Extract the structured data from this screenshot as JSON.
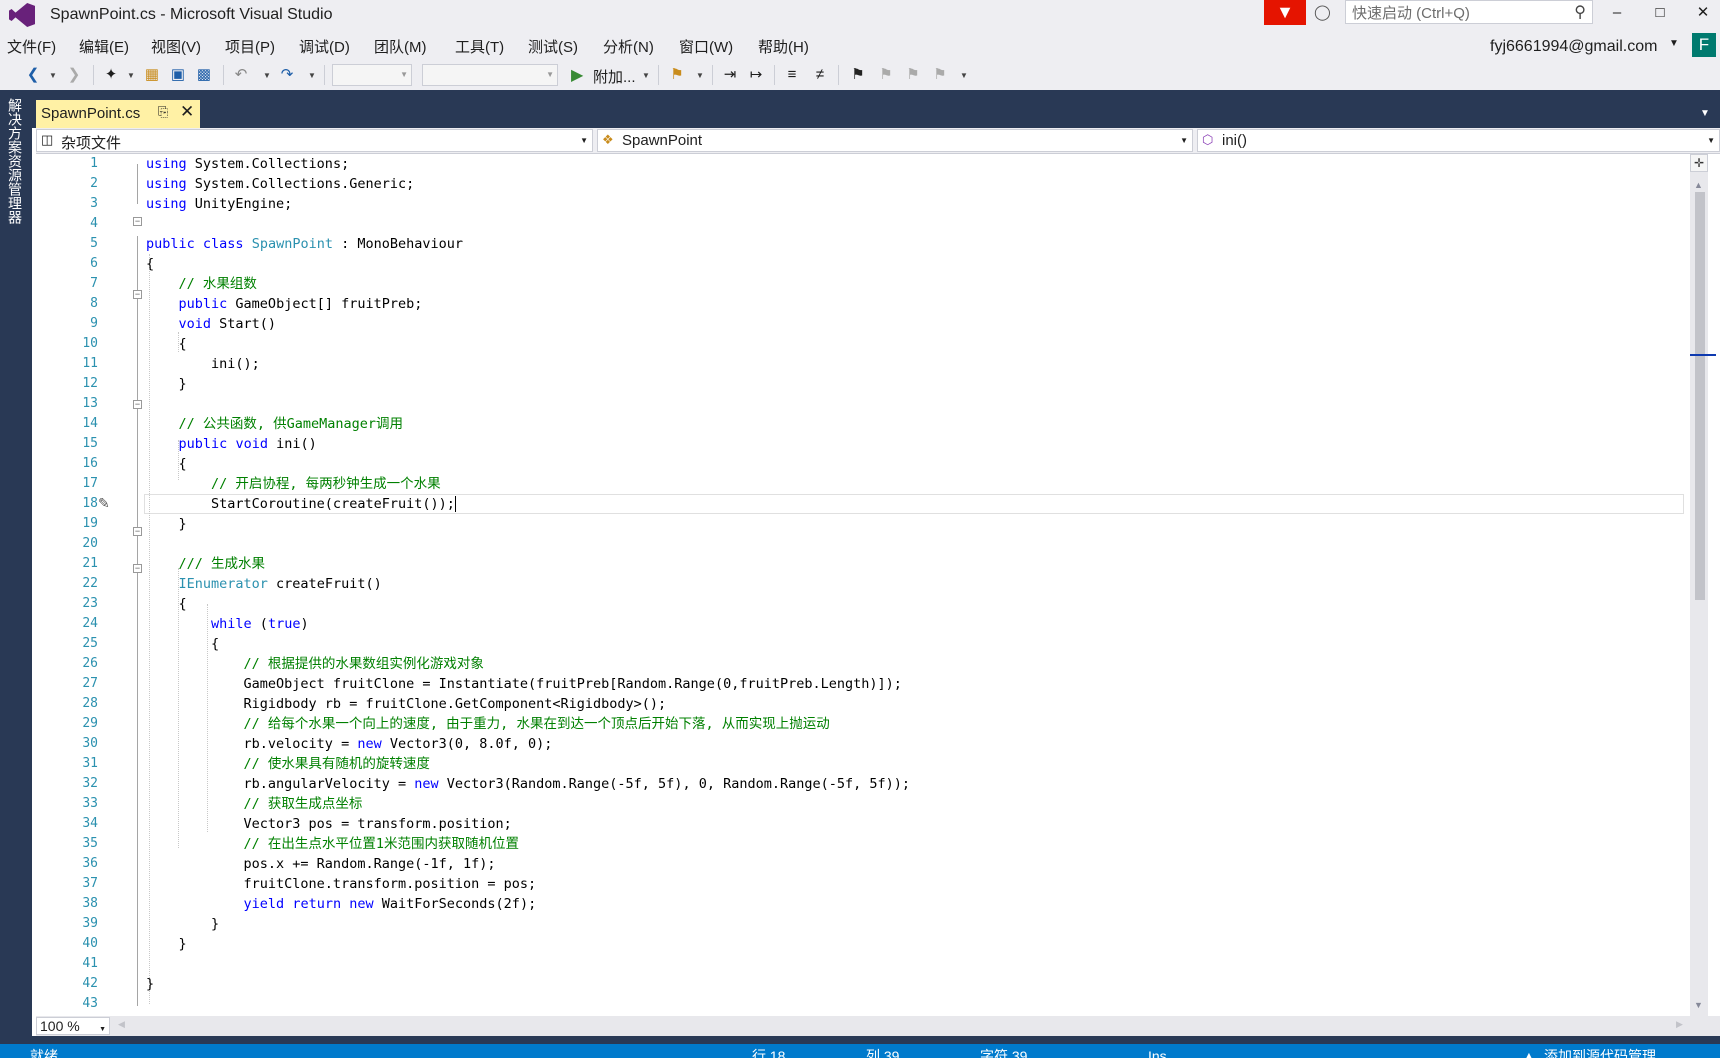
{
  "window": {
    "title": "SpawnPoint.cs - Microsoft Visual Studio",
    "quick_launch_placeholder": "快速启动 (Ctrl+Q)",
    "minimize": "–",
    "maximize": "□",
    "close": "✕"
  },
  "menu": [
    "文件(F)",
    "编辑(E)",
    "视图(V)",
    "项目(P)",
    "调试(D)",
    "团队(M)",
    "工具(T)",
    "测试(S)",
    "分析(N)",
    "窗口(W)",
    "帮助(H)"
  ],
  "account": {
    "email": "fyj6661994@gmail.com",
    "avatar_letter": "F"
  },
  "toolbar": {
    "attach_label": "附加..."
  },
  "solution_explorer_tab": "解决方案资源管理器",
  "document_tab": {
    "label": "SpawnPoint.cs"
  },
  "nav": {
    "project": "杂项文件",
    "class": "SpawnPoint",
    "member": "ini()"
  },
  "editor": {
    "current_line": 18,
    "line_numbers": [
      "1",
      "2",
      "3",
      "4",
      "5",
      "6",
      "7",
      "8",
      "9",
      "10",
      "11",
      "12",
      "13",
      "14",
      "15",
      "16",
      "17",
      "18",
      "19",
      "20",
      "21",
      "22",
      "23",
      "24",
      "25",
      "26",
      "27",
      "28",
      "29",
      "30",
      "31",
      "32",
      "33",
      "34",
      "35",
      "36",
      "37",
      "38",
      "39",
      "40",
      "41",
      "42",
      "43"
    ],
    "code": [
      [
        {
          "t": "using",
          "c": "kw"
        },
        {
          "t": " System.Collections;"
        }
      ],
      [
        {
          "t": "using",
          "c": "kw"
        },
        {
          "t": " System.Collections.Generic;"
        }
      ],
      [
        {
          "t": "using",
          "c": "kw"
        },
        {
          "t": " UnityEngine;"
        }
      ],
      [],
      [
        {
          "t": "public",
          "c": "kw"
        },
        {
          "t": " "
        },
        {
          "t": "class",
          "c": "kw"
        },
        {
          "t": " "
        },
        {
          "t": "SpawnPoint",
          "c": "ty"
        },
        {
          "t": " : MonoBehaviour"
        }
      ],
      [
        {
          "t": "{"
        }
      ],
      [
        {
          "t": "    "
        },
        {
          "t": "// 水果组数",
          "c": "cm"
        }
      ],
      [
        {
          "t": "    "
        },
        {
          "t": "public",
          "c": "kw"
        },
        {
          "t": " GameObject[] fruitPreb;"
        }
      ],
      [
        {
          "t": "    "
        },
        {
          "t": "void",
          "c": "kw"
        },
        {
          "t": " Start()"
        }
      ],
      [
        {
          "t": "    {"
        }
      ],
      [
        {
          "t": "        ini();"
        }
      ],
      [
        {
          "t": "    }"
        }
      ],
      [],
      [
        {
          "t": "    "
        },
        {
          "t": "// 公共函数, 供GameManager调用",
          "c": "cm"
        }
      ],
      [
        {
          "t": "    "
        },
        {
          "t": "public",
          "c": "kw"
        },
        {
          "t": " "
        },
        {
          "t": "void",
          "c": "kw"
        },
        {
          "t": " ini()"
        }
      ],
      [
        {
          "t": "    {"
        }
      ],
      [
        {
          "t": "        "
        },
        {
          "t": "// 开启协程, 每两秒钟生成一个水果",
          "c": "cm"
        }
      ],
      [
        {
          "t": "        StartCoroutine(createFruit());"
        },
        {
          "caret": true
        }
      ],
      [
        {
          "t": "    }"
        }
      ],
      [],
      [
        {
          "t": "    "
        },
        {
          "t": "/// 生成水果",
          "c": "cm"
        }
      ],
      [
        {
          "t": "    "
        },
        {
          "t": "IEnumerator",
          "c": "ty"
        },
        {
          "t": " createFruit()"
        }
      ],
      [
        {
          "t": "    {"
        }
      ],
      [
        {
          "t": "        "
        },
        {
          "t": "while",
          "c": "kw"
        },
        {
          "t": " ("
        },
        {
          "t": "true",
          "c": "kw"
        },
        {
          "t": ")"
        }
      ],
      [
        {
          "t": "        {"
        }
      ],
      [
        {
          "t": "            "
        },
        {
          "t": "// 根据提供的水果数组实例化游戏对象",
          "c": "cm"
        }
      ],
      [
        {
          "t": "            GameObject fruitClone = Instantiate(fruitPreb[Random.Range(0,fruitPreb.Length)]);"
        }
      ],
      [
        {
          "t": "            Rigidbody rb = fruitClone.GetComponent<Rigidbody>();"
        }
      ],
      [
        {
          "t": "            "
        },
        {
          "t": "// 给每个水果一个向上的速度, 由于重力, 水果在到达一个顶点后开始下落, 从而实现上抛运动",
          "c": "cm"
        }
      ],
      [
        {
          "t": "            rb.velocity = "
        },
        {
          "t": "new",
          "c": "kw"
        },
        {
          "t": " Vector3(0, 8.0f, 0);"
        }
      ],
      [
        {
          "t": "            "
        },
        {
          "t": "// 使水果具有随机的旋转速度",
          "c": "cm"
        }
      ],
      [
        {
          "t": "            rb.angularVelocity = "
        },
        {
          "t": "new",
          "c": "kw"
        },
        {
          "t": " Vector3(Random.Range(-5f, 5f), 0, Random.Range(-5f, 5f));"
        }
      ],
      [
        {
          "t": "            "
        },
        {
          "t": "// 获取生成点坐标",
          "c": "cm"
        }
      ],
      [
        {
          "t": "            Vector3 pos = transform.position;"
        }
      ],
      [
        {
          "t": "            "
        },
        {
          "t": "// 在出生点水平位置1米范围内获取随机位置",
          "c": "cm"
        }
      ],
      [
        {
          "t": "            pos.x += Random.Range(-1f, 1f);"
        }
      ],
      [
        {
          "t": "            fruitClone.transform.position = pos;"
        }
      ],
      [
        {
          "t": "            "
        },
        {
          "t": "yield",
          "c": "kw"
        },
        {
          "t": " "
        },
        {
          "t": "return",
          "c": "kw"
        },
        {
          "t": " "
        },
        {
          "t": "new",
          "c": "kw"
        },
        {
          "t": " WaitForSeconds(2f);"
        }
      ],
      [
        {
          "t": "        }"
        }
      ],
      [
        {
          "t": "    }"
        }
      ],
      [],
      [
        {
          "t": "}"
        }
      ],
      []
    ]
  },
  "zoom": "100 %",
  "status": {
    "ready": "就绪",
    "line": "行 18",
    "col": "列 39",
    "ch": "字符 39",
    "mode": "Ins",
    "source_control": "添加到源代码管理"
  },
  "colors": {
    "accent": "#007acc",
    "frame": "#293955",
    "tab_active": "#fff1a5",
    "keyword": "#0000ff",
    "type": "#2b91af",
    "comment": "#008000"
  }
}
